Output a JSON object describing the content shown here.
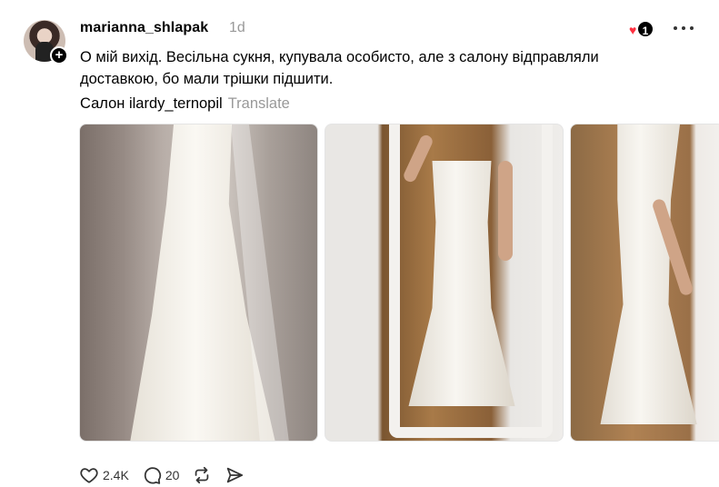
{
  "post": {
    "username": "marianna_shlapak",
    "time": "1d",
    "reaction_count": "1",
    "text_line1": "О мій вихід. Весільна сукня, купувала особисто, але з салону відправляли",
    "text_line2": "доставкою, бо мали трішки підшити.",
    "text_line3": "Салон ilardy_ternopil",
    "translate": "Translate"
  },
  "actions": {
    "likes": "2.4K",
    "comments": "20"
  },
  "colors": {
    "heart": "#ff3040",
    "muted": "#999999"
  },
  "icons": [
    "plus-icon",
    "heart-icon",
    "more-icon",
    "like-icon",
    "comment-icon",
    "repost-icon",
    "share-icon"
  ]
}
